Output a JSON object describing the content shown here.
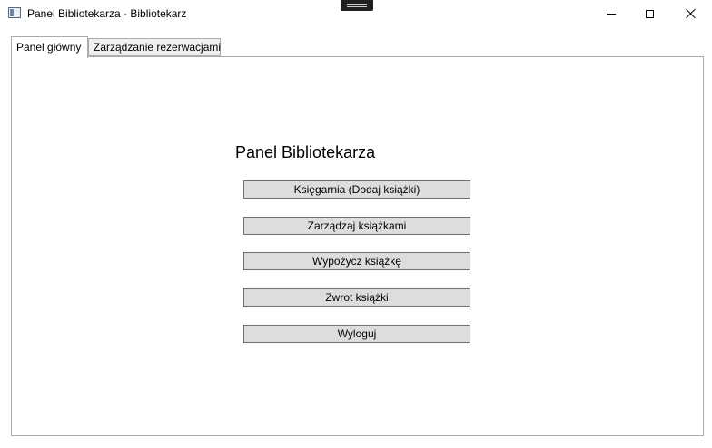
{
  "window": {
    "title": "Panel Bibliotekarza - Bibliotekarz",
    "icon": "app-window-icon",
    "controls": [
      "minimize-icon",
      "maximize-icon",
      "close-icon"
    ]
  },
  "tabs": [
    {
      "label": "Panel główny",
      "active": true
    },
    {
      "label": "Zarządzanie rezerwacjami",
      "active": false
    }
  ],
  "main": {
    "heading": "Panel Bibliotekarza",
    "buttons": [
      {
        "label": "Księgarnia (Dodaj książki)"
      },
      {
        "label": "Zarządzaj książkami"
      },
      {
        "label": "Wypożycz książkę"
      },
      {
        "label": "Zwrot książki"
      },
      {
        "label": "Wyloguj"
      }
    ]
  },
  "colors": {
    "button_face": "#dddddd",
    "button_border": "#707070",
    "tab_border": "#acacac",
    "inactive_tab": "#f0f0f0"
  }
}
